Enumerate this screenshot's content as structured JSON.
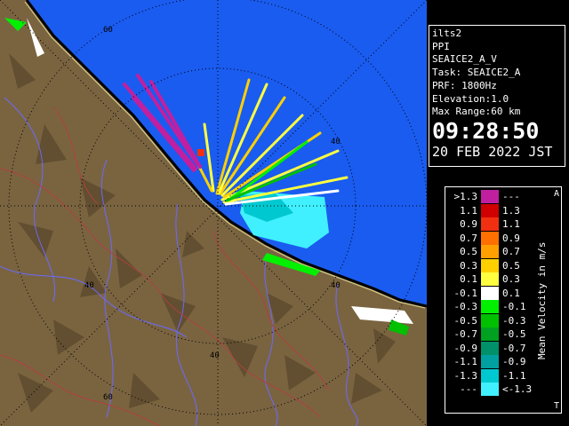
{
  "map": {
    "range_labels": [
      "60",
      "40",
      "40",
      "40",
      "40",
      "60"
    ],
    "colors": {
      "sea": "#1a5cf0",
      "land": "#7a6440",
      "coast": "#000000",
      "river": "#6a6aff",
      "border": "#b04040",
      "rings": "#000000"
    }
  },
  "info": {
    "lines": [
      "ilts2",
      "PPI",
      "SEAICE2_A_V",
      "Task: SEAICE2_A",
      "PRF: 1800Hz",
      "Elevation:1.0",
      "Max Range:60 km"
    ],
    "time": "09:28:50",
    "date": "20 FEB 2022 JST"
  },
  "legend": {
    "unit": "Mean Velocity in m/s",
    "corner_top": "A",
    "corner_bottom": "T",
    "rows": [
      {
        "left": ">1.3",
        "right": "---",
        "color": "#c020a0"
      },
      {
        "left": "1.1",
        "right": "1.3",
        "color": "#d00000"
      },
      {
        "left": "0.9",
        "right": "1.1",
        "color": "#f03010"
      },
      {
        "left": "0.7",
        "right": "0.9",
        "color": "#ff7000"
      },
      {
        "left": "0.5",
        "right": "0.7",
        "color": "#ffa000"
      },
      {
        "left": "0.3",
        "right": "0.5",
        "color": "#ffd000"
      },
      {
        "left": "0.1",
        "right": "0.3",
        "color": "#ffff40"
      },
      {
        "left": "-0.1",
        "right": "0.1",
        "color": "#ffffff"
      },
      {
        "left": "-0.3",
        "right": "-0.1",
        "color": "#00f000"
      },
      {
        "left": "-0.5",
        "right": "-0.3",
        "color": "#00c000"
      },
      {
        "left": "-0.7",
        "right": "-0.5",
        "color": "#00a020"
      },
      {
        "left": "-0.9",
        "right": "-0.7",
        "color": "#00906a"
      },
      {
        "left": "-1.1",
        "right": "-0.9",
        "color": "#00a0a0"
      },
      {
        "left": "-1.3",
        "right": "-1.1",
        "color": "#00c8d0"
      },
      {
        "left": "---",
        "right": "<-1.3",
        "color": "#40f0ff"
      }
    ]
  }
}
